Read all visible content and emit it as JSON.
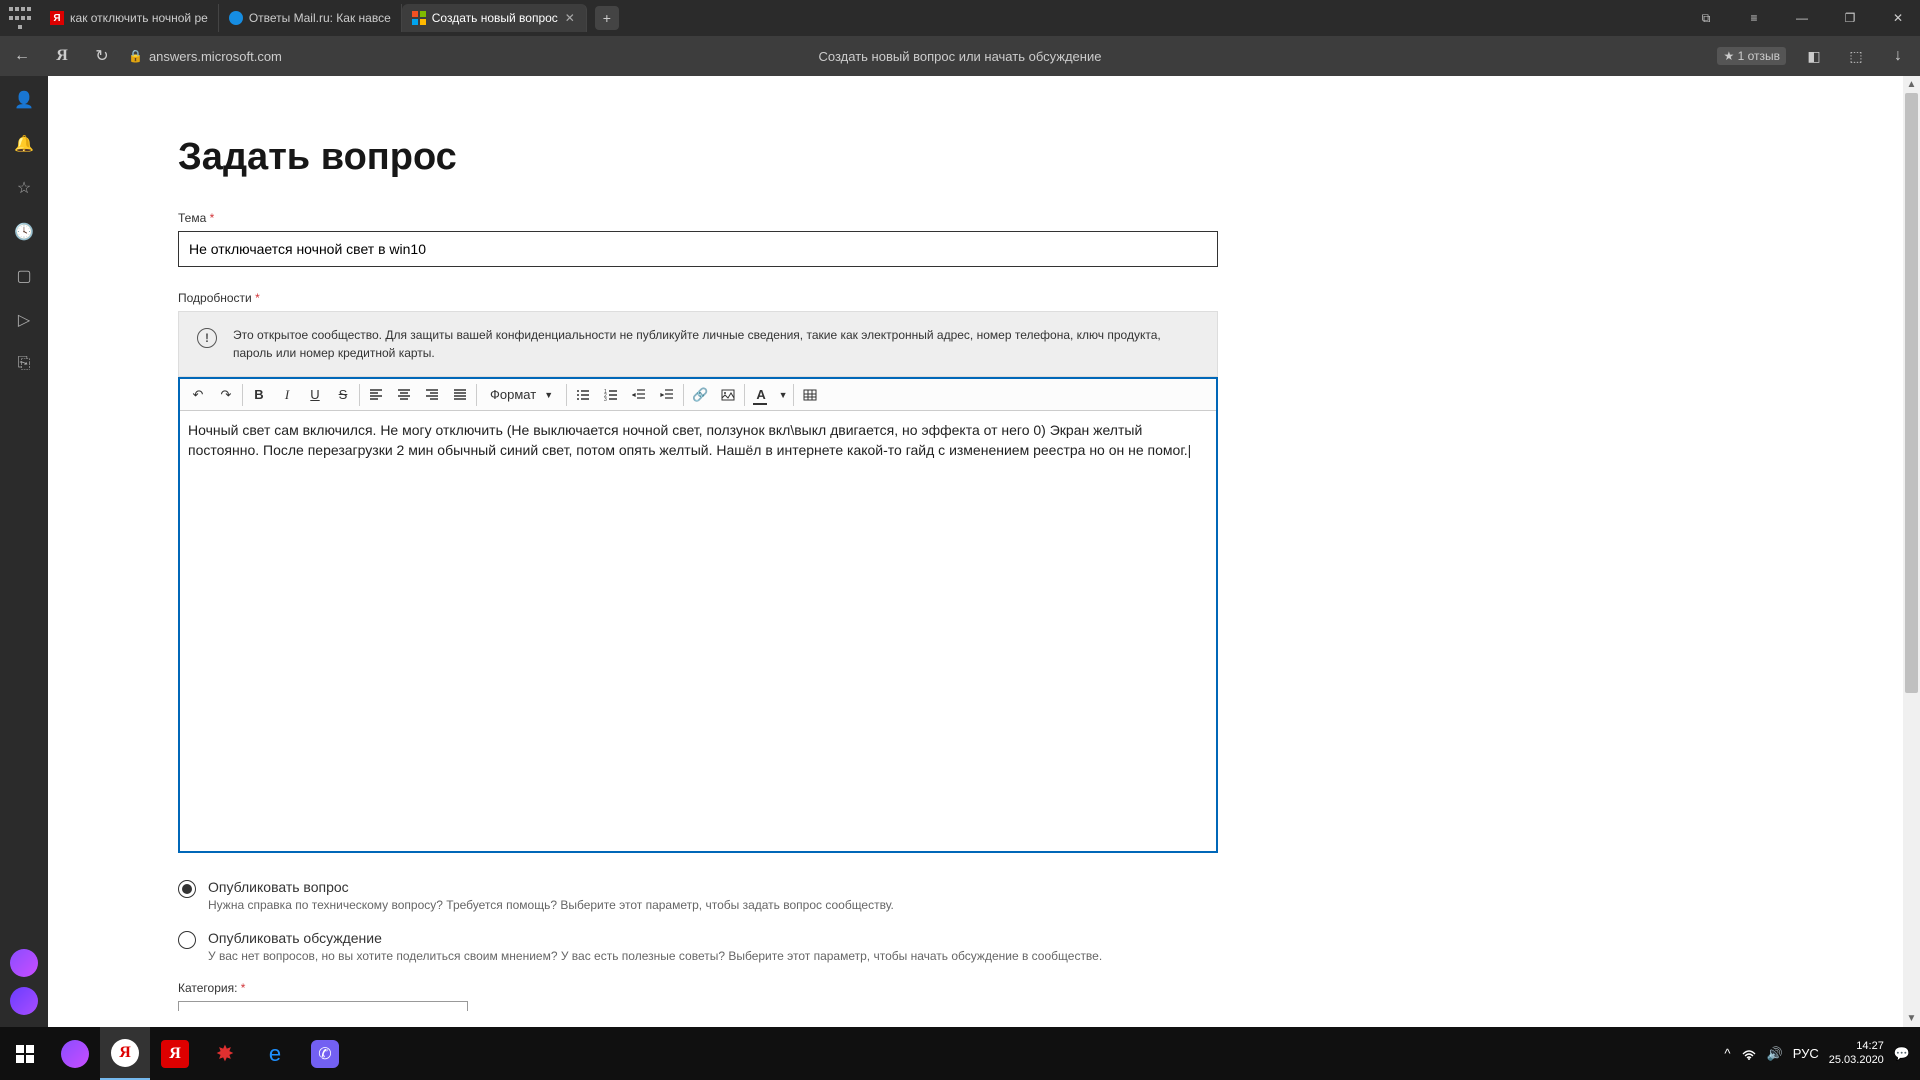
{
  "browser": {
    "tabs": [
      {
        "label": "как отключить ночной ре"
      },
      {
        "label": "Ответы Mail.ru: Как навсе"
      },
      {
        "label": "Создать новый вопрос"
      }
    ],
    "url": "answers.microsoft.com",
    "page_title": "Создать новый вопрос или начать обсуждение",
    "reviews": "★ 1 отзыв"
  },
  "form": {
    "heading": "Задать вопрос",
    "subject_label": "Тема",
    "subject_value": "Не отключается ночной свет в win10",
    "details_label": "Подробности",
    "warning": "Это открытое сообщество. Для защиты вашей конфиденциальности не публикуйте личные сведения, такие как электронный адрес, номер телефона, ключ продукта, пароль или номер кредитной карты.",
    "format_label": "Формат",
    "body_text": "Ночный свет сам включился. Не могу отключить (Не выключается ночной свет, ползунок вкл\\выкл двигается, но эффекта от него 0) Экран желтый постоянно. После перезагрузки 2 мин обычный синий свет, потом опять желтый. Нашёл в интернете какой-то гайд с изменением реестра но он не помог.",
    "options": {
      "question": {
        "label": "Опубликовать вопрос",
        "desc": "Нужна справка по техническому вопросу? Требуется помощь? Выберите этот параметр, чтобы задать вопрос сообществу."
      },
      "discussion": {
        "label": "Опубликовать обсуждение",
        "desc": "У вас нет вопросов, но вы хотите поделиться своим мнением? У вас есть полезные советы? Выберите этот параметр, чтобы начать обсуждение в сообществе."
      }
    },
    "category_label": "Категория:"
  },
  "taskbar": {
    "lang": "РУС",
    "time": "14:27",
    "date": "25.03.2020"
  }
}
